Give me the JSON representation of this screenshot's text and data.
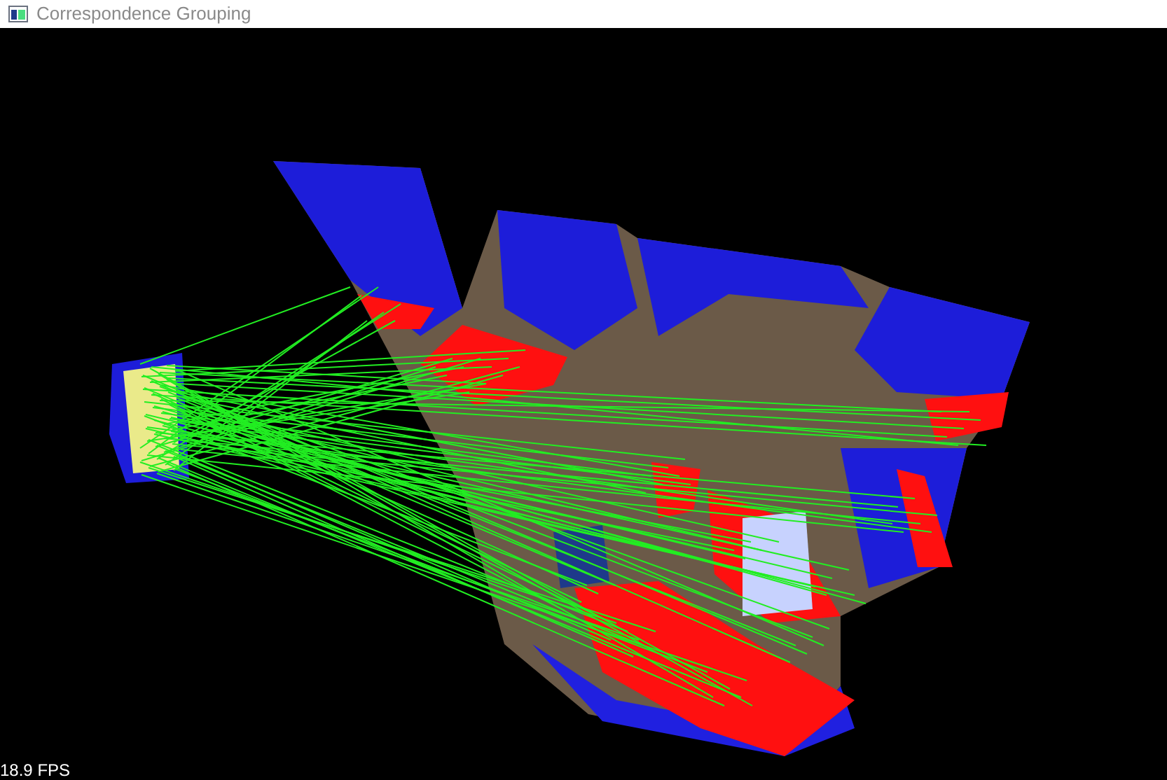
{
  "window": {
    "title": "Correspondence Grouping"
  },
  "viewport": {
    "fps": "18.9 FPS"
  }
}
